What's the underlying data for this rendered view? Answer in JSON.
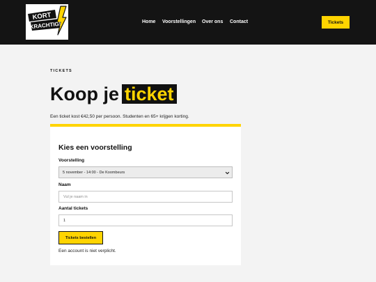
{
  "brand": {
    "logo_line1": "KORT",
    "logo_line2": "KRACHTIG!"
  },
  "nav": {
    "items": [
      "Home",
      "Voorstellingen",
      "Over ons",
      "Contact"
    ],
    "cta_label": "Tickets"
  },
  "page": {
    "eyebrow": "TICKETS",
    "heading_prefix": "Koop je",
    "heading_highlight": "ticket",
    "intro": "Een ticket kost €42,50 per persoon. Studenten en 65+ krijgen korting."
  },
  "form": {
    "title": "Kies een voorstelling",
    "show_label": "Voorstelling",
    "show_value": "5 november - 14:00 - De Koombeurs",
    "name_label": "Naam",
    "name_placeholder": "Vul je naam in",
    "qty_label": "Aantal tickets",
    "qty_value": "1",
    "submit_label": "Tickets bestellen",
    "note": "Een account is niet verplicht."
  },
  "colors": {
    "accent": "#ffd400",
    "header_bg": "#141414",
    "page_bg": "#f3f3f3"
  },
  "icons": {
    "logo": "lightning-bolt-icon",
    "select_arrow": "chevron-down-icon"
  }
}
